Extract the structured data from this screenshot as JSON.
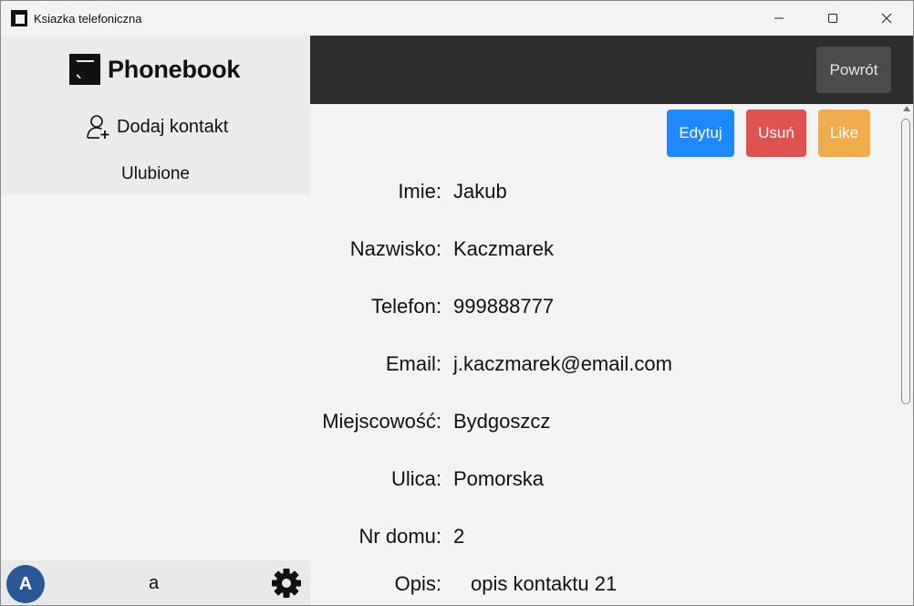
{
  "window": {
    "title": "Ksiazka telefoniczna",
    "controls": {
      "minimize": "—",
      "maximize": "☐",
      "close": "✕"
    }
  },
  "sidebar": {
    "logo_text": "Phonebook",
    "add_contact_label": "Dodaj kontakt",
    "favorites_label": "Ulubione",
    "user": {
      "avatar_initial": "A",
      "name": "a",
      "avatar_color": "#2b5797"
    }
  },
  "header": {
    "back_label": "Powrót"
  },
  "actions": {
    "edit_label": "Edytuj",
    "delete_label": "Usuń",
    "like_label": "Like",
    "colors": {
      "edit": "#1e88ff",
      "delete": "#de5350",
      "like": "#f0ad4e"
    }
  },
  "contact": {
    "first_name": {
      "label": "Imie:",
      "value": "Jakub"
    },
    "last_name": {
      "label": "Nazwisko:",
      "value": "Kaczmarek"
    },
    "phone": {
      "label": "Telefon:",
      "value": "999888777"
    },
    "email": {
      "label": "Email:",
      "value": "j.kaczmarek@email.com"
    },
    "city": {
      "label": "Miejscowość:",
      "value": "Bydgoszcz"
    },
    "street": {
      "label": "Ulica:",
      "value": "Pomorska"
    },
    "house_number": {
      "label": "Nr domu:",
      "value": "2"
    },
    "description": {
      "label": "Opis:",
      "value": "opis kontaktu 21"
    }
  }
}
